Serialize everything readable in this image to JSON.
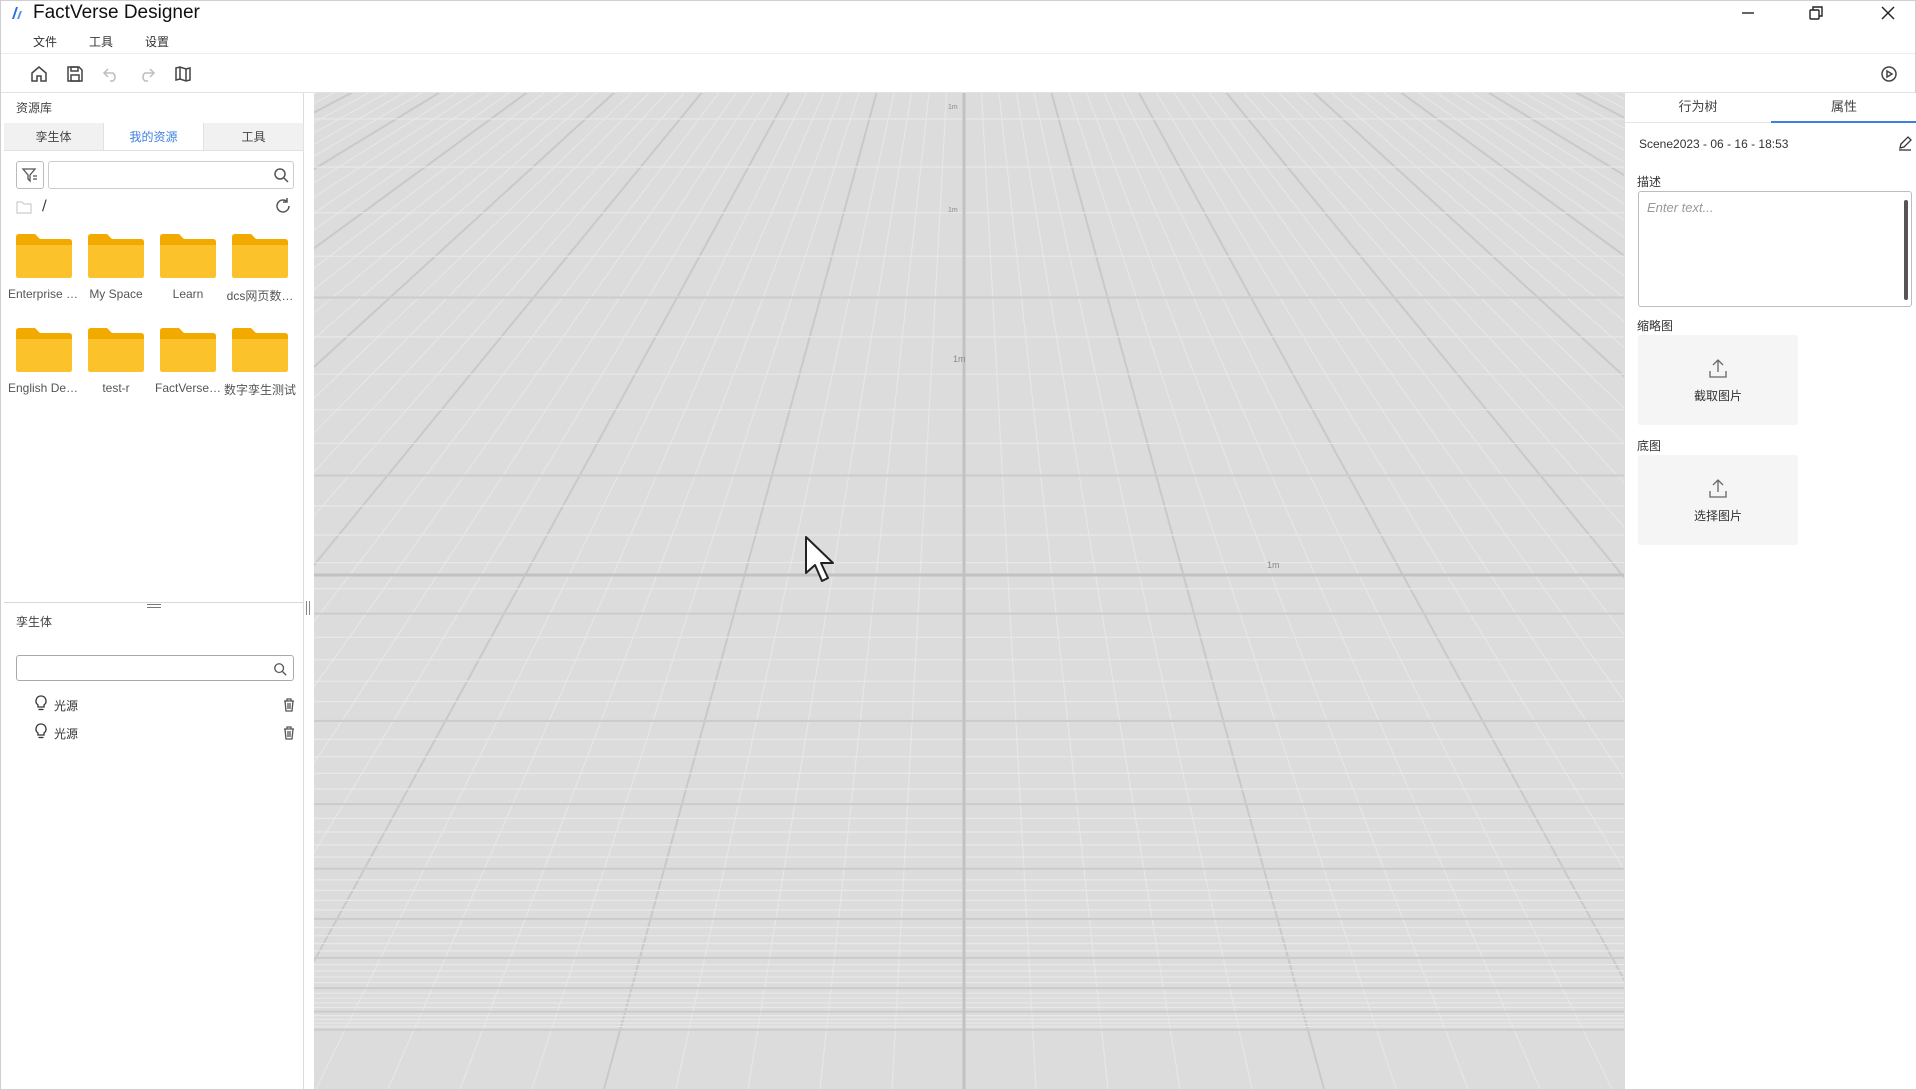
{
  "window": {
    "title": "FactVerse Designer"
  },
  "menu": {
    "items": [
      "文件",
      "工具",
      "设置"
    ]
  },
  "left_panel": {
    "caption": "资源库",
    "tabs": [
      {
        "label": "孪生体",
        "active": false
      },
      {
        "label": "我的资源",
        "active": true
      },
      {
        "label": "工具",
        "active": false
      }
    ],
    "search_value": "",
    "path": "/",
    "folders": [
      {
        "label": "Enterprise s…"
      },
      {
        "label": "My Space"
      },
      {
        "label": "Learn"
      },
      {
        "label": "dcs网页数…"
      },
      {
        "label": "English Demo"
      },
      {
        "label": "test-r"
      },
      {
        "label": "FactVerse…"
      },
      {
        "label": "数字孪生测试"
      }
    ]
  },
  "twin_panel": {
    "caption": "孪生体",
    "search_value": "",
    "items": [
      {
        "label": "光源",
        "icon": "bulb-icon"
      },
      {
        "label": "光源",
        "icon": "bulb-icon"
      }
    ]
  },
  "viewport": {
    "grid_labels": [
      "1m",
      "1m",
      "1m",
      "1m"
    ]
  },
  "right_panel": {
    "tabs": [
      {
        "label": "行为树",
        "active": false
      },
      {
        "label": "属性",
        "active": true
      }
    ],
    "scene_name": "Scene2023 - 06 - 16 - 18:53",
    "description_label": "描述",
    "description_placeholder": "Enter text...",
    "thumbnail_label": "缩略图",
    "thumbnail_button": "截取图片",
    "base_map_label": "底图",
    "base_map_button": "选择图片"
  },
  "colors": {
    "accent": "#3f7fdf",
    "folder": "#f7b500",
    "viewport_bg": "#dcdcdc"
  }
}
